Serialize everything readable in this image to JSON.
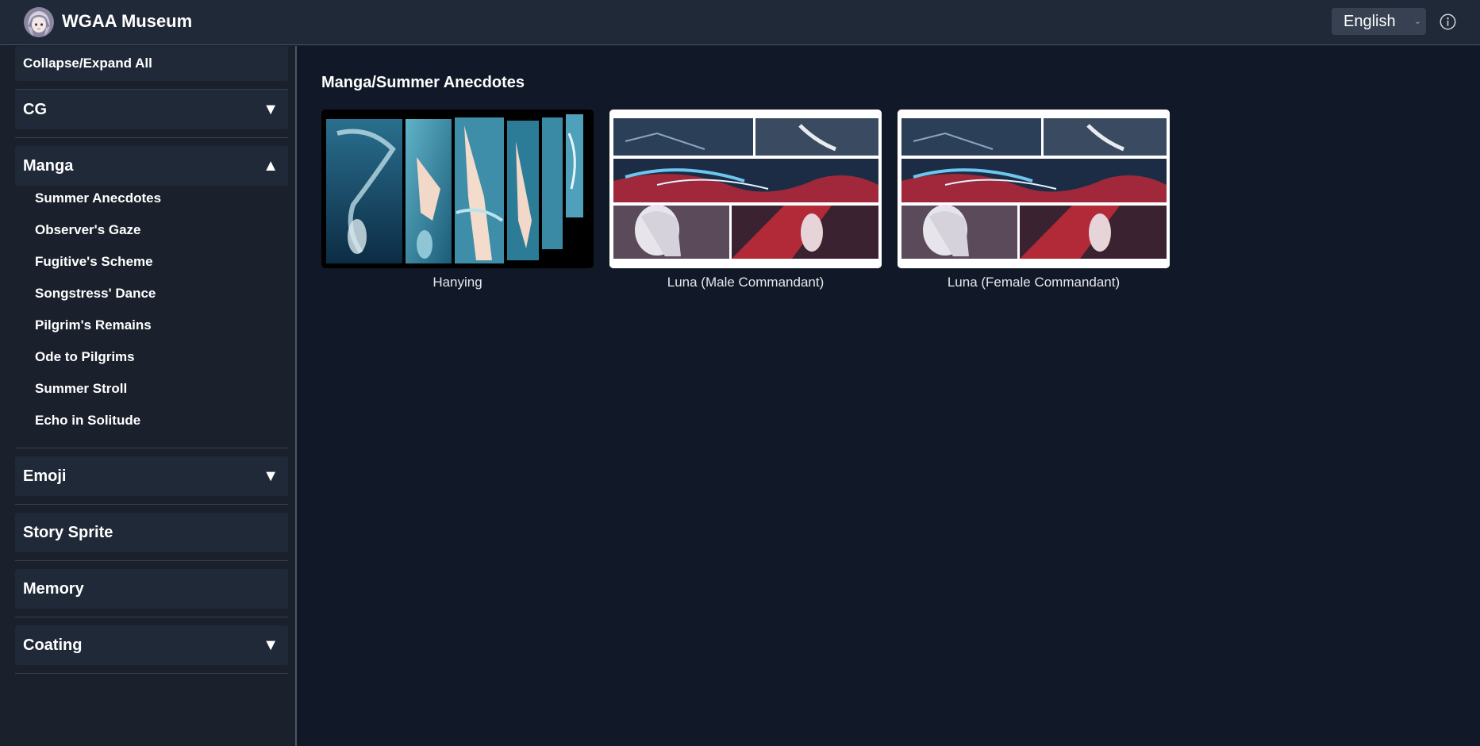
{
  "header": {
    "title": "WGAA Museum",
    "language": "English"
  },
  "sidebar": {
    "collapse_label": "Collapse/Expand All",
    "sections": [
      {
        "label": "CG",
        "arrow": "▼"
      },
      {
        "label": "Manga",
        "arrow": "▲"
      },
      {
        "label": "Emoji",
        "arrow": "▼"
      },
      {
        "label": "Story Sprite"
      },
      {
        "label": "Memory"
      },
      {
        "label": "Coating",
        "arrow": "▼"
      }
    ],
    "manga_items": [
      "Summer Anecdotes",
      "Observer's Gaze",
      "Fugitive's Scheme",
      "Songstress' Dance",
      "Pilgrim's Remains",
      "Ode to Pilgrims",
      "Summer Stroll",
      "Echo in Solitude"
    ]
  },
  "main": {
    "title": "Manga/Summer Anecdotes",
    "cards": [
      {
        "label": "Hanying"
      },
      {
        "label": "Luna (Male Commandant)"
      },
      {
        "label": "Luna (Female Commandant)"
      }
    ]
  }
}
